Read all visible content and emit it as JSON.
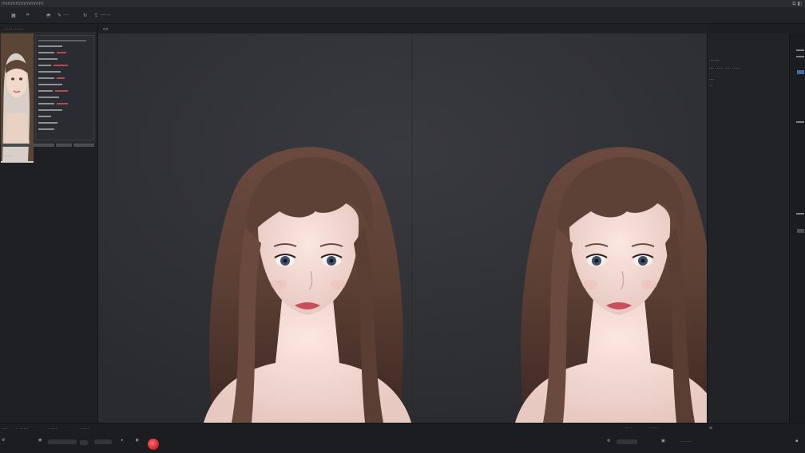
{
  "window": {
    "title": "mmmmmmmmm",
    "corner": "⧉ ◧"
  },
  "toolbar": {
    "items": [
      {
        "icon": "grid-icon",
        "glyph": "▦",
        "label": ""
      },
      {
        "icon": "crop-icon",
        "glyph": "⌗",
        "label": ""
      },
      {
        "icon": "mask-icon",
        "glyph": "◓",
        "label": ""
      },
      {
        "icon": "brush-icon",
        "glyph": "✎",
        "label": "····"
      },
      {
        "icon": "rotate-icon",
        "glyph": "↻",
        "label": ""
      },
      {
        "icon": "export-icon",
        "glyph": "⇪",
        "label": "·······"
      }
    ]
  },
  "left_panel": {
    "header": "······· ········",
    "footer_tabs": [
      "·······",
      "····",
      "······",
      "·······"
    ],
    "sub_label": "·······"
  },
  "canvas": {
    "tab_icon": "▭"
  },
  "right_panel": {
    "rows": [
      "········",
      "···· ······ ····· ······",
      "····",
      "···"
    ]
  },
  "bottom_bar": {
    "left_items": [
      "·····",
      "·· ·······",
      "········",
      "·······"
    ],
    "right_items": [
      "······",
      "·······",
      "·········"
    ],
    "record_color": "#d8343c"
  }
}
